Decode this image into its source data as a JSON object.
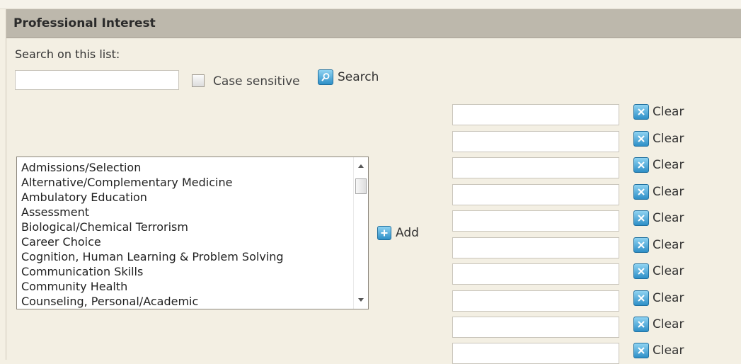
{
  "panel": {
    "title": "Professional Interest"
  },
  "search": {
    "label": "Search on this list:",
    "value": "",
    "case_sensitive_label": "Case sensitive",
    "case_sensitive_checked": false,
    "button_label": "Search",
    "button_icon": "magnifier-icon"
  },
  "list": {
    "items": [
      "Admissions/Selection",
      "Alternative/Complementary Medicine",
      "Ambulatory Education",
      "Assessment",
      "Biological/Chemical Terrorism",
      "Career Choice",
      "Cognition, Human Learning & Problem Solving",
      "Communication Skills",
      "Community Health",
      "Counseling, Personal/Academic"
    ]
  },
  "add": {
    "label": "Add",
    "icon": "plus-icon"
  },
  "selected": {
    "clear_label": "Clear",
    "clear_icon": "x-icon",
    "slots": [
      "",
      "",
      "",
      "",
      "",
      "",
      "",
      "",
      "",
      ""
    ]
  },
  "colors": {
    "header_bg": "#bdb8ac",
    "panel_bg": "#f3efe3",
    "icon_blue": "#2e8fc7"
  }
}
